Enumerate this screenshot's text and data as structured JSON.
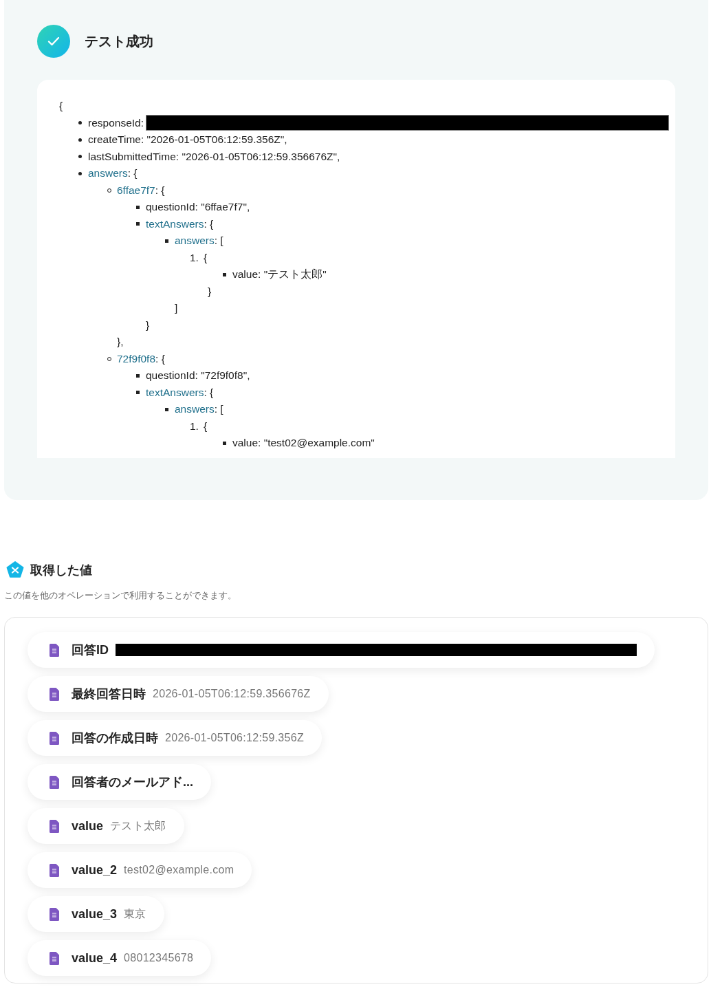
{
  "test_result": {
    "title": "テスト成功",
    "json_open": "{",
    "json_items": [
      {
        "key": "responseId",
        "rest": ":",
        "link": false,
        "redacted": true
      },
      {
        "key": "createTime",
        "rest": ": \"2026-01-05T06:12:59.356Z\",",
        "link": false
      },
      {
        "key": "lastSubmittedTime",
        "rest": ": \"2026-01-05T06:12:59.356676Z\",",
        "link": false
      },
      {
        "key": "answers",
        "rest": ": {",
        "link": true,
        "children": [
          {
            "key": "6ffae7f7",
            "rest": ": {",
            "link": true,
            "close": "},",
            "children": [
              {
                "key": "questionId",
                "rest": ": \"6ffae7f7\",",
                "link": false
              },
              {
                "key": "textAnswers",
                "rest": ": {",
                "link": true,
                "close": "}",
                "children": [
                  {
                    "key": "answers",
                    "rest": ": [",
                    "link": true,
                    "close": "]",
                    "children": [
                      {
                        "marker": "1.",
                        "rest": "{",
                        "close": "}",
                        "children": [
                          {
                            "key": "value",
                            "rest": ": \"テスト太郎\"",
                            "link": false
                          }
                        ]
                      }
                    ]
                  }
                ]
              }
            ]
          },
          {
            "key": "72f9f0f8",
            "rest": ": {",
            "link": true,
            "children": [
              {
                "key": "questionId",
                "rest": ": \"72f9f0f8\",",
                "link": false
              },
              {
                "key": "textAnswers",
                "rest": ": {",
                "link": true,
                "children": [
                  {
                    "key": "answers",
                    "rest": ": [",
                    "link": true,
                    "children": [
                      {
                        "marker": "1.",
                        "rest": "{",
                        "children": [
                          {
                            "key": "value",
                            "rest": ": \"test02@example.com\"",
                            "link": false
                          }
                        ]
                      }
                    ]
                  }
                ]
              }
            ]
          }
        ]
      }
    ]
  },
  "values": {
    "title": "取得した値",
    "description": "この値を他のオペレーションで利用することができます。",
    "items": [
      {
        "label": "回答ID",
        "redacted": true
      },
      {
        "label": "最終回答日時",
        "value": "2026-01-05T06:12:59.356676Z"
      },
      {
        "label": "回答の作成日時",
        "value": "2026-01-05T06:12:59.356Z"
      },
      {
        "label": "回答者のメールアド..."
      },
      {
        "label": "value",
        "value": "テスト太郎"
      },
      {
        "label": "value_2",
        "value": "test02@example.com"
      },
      {
        "label": "value_3",
        "value": "東京"
      },
      {
        "label": "value_4",
        "value": "08012345678"
      }
    ]
  }
}
